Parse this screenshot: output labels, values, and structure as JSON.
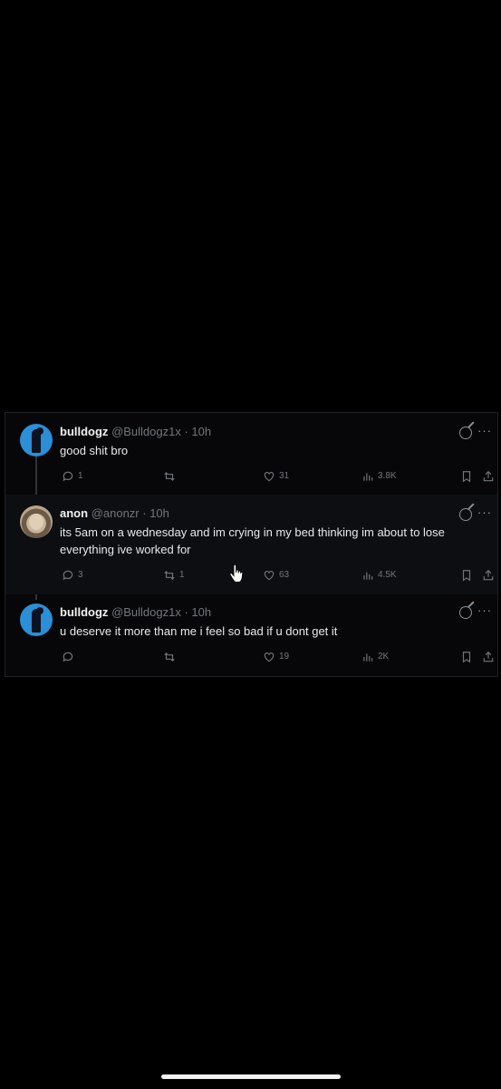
{
  "tweets": [
    {
      "name": "bulldogz",
      "handle": "@Bulldogz1x",
      "time": "· 10h",
      "text": "good shit bro",
      "replies": "1",
      "reposts": "",
      "likes": "31",
      "views": "3.8K"
    },
    {
      "name": "anon",
      "handle": "@anonzr",
      "time": "· 10h",
      "text": "its 5am on a wednesday and im crying in my bed thinking im about to lose everything ive worked for",
      "replies": "3",
      "reposts": "1",
      "likes": "63",
      "views": "4.5K"
    },
    {
      "name": "bulldogz",
      "handle": "@Bulldogz1x",
      "time": "· 10h",
      "text": "u deserve it more than me i feel so bad if u dont get it",
      "replies": "",
      "reposts": "",
      "likes": "19",
      "views": "2K"
    }
  ],
  "icons": {
    "reply": "reply-icon",
    "repost": "repost-icon",
    "like": "heart-icon",
    "views": "views-icon",
    "bookmark": "bookmark-icon",
    "share": "share-icon",
    "grok": "grok-icon",
    "more": "more-icon"
  },
  "more_glyph": "···"
}
